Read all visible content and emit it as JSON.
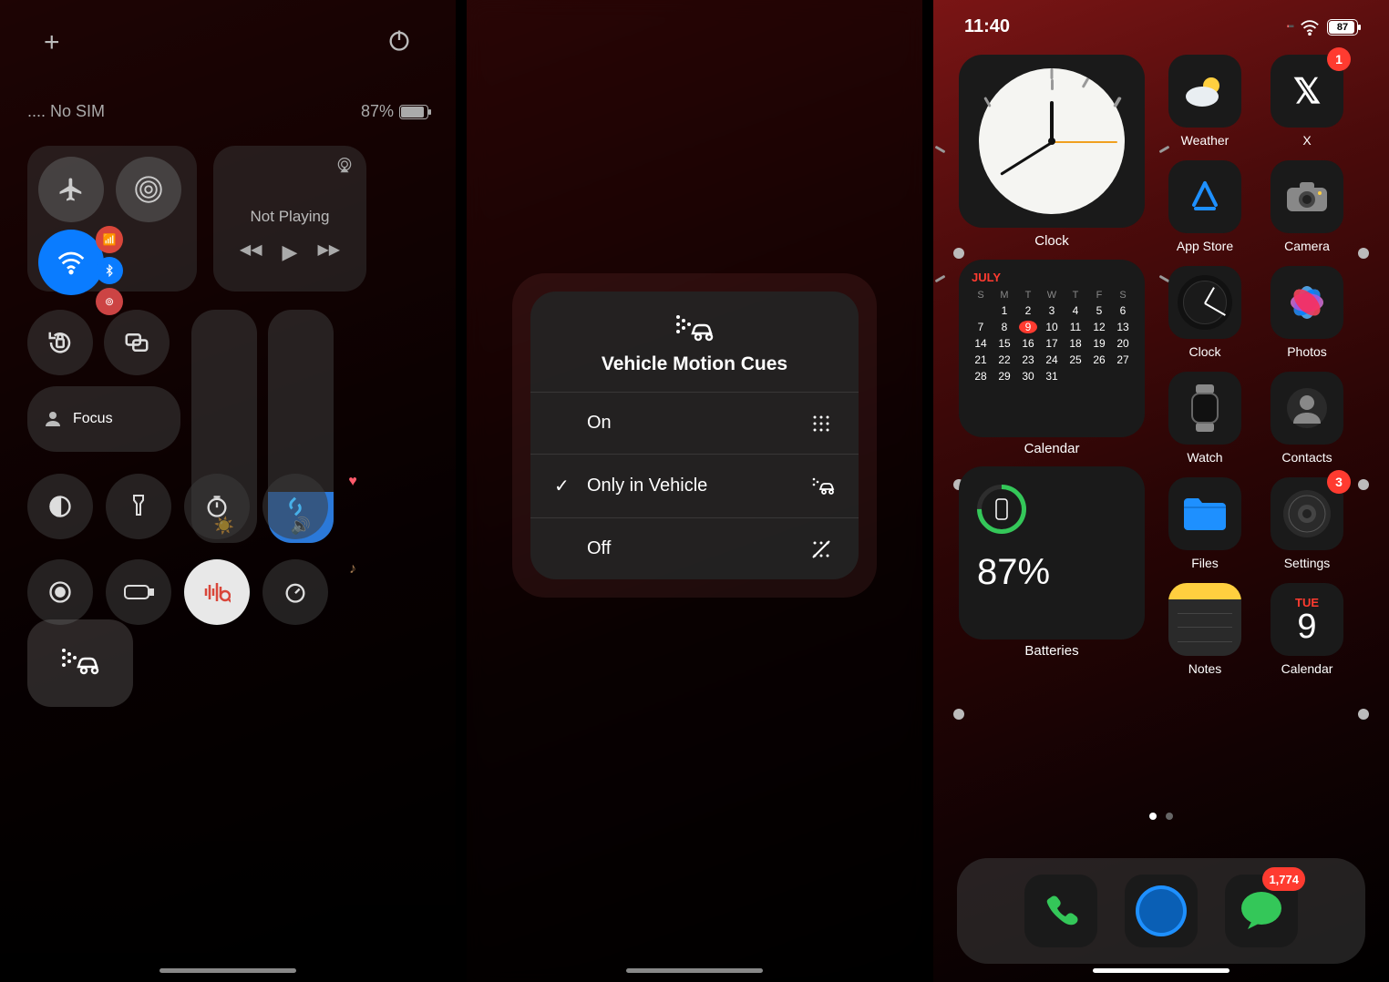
{
  "screens": {
    "control_center": {
      "status": {
        "carrier": ".... No SIM",
        "battery_text": "87%"
      },
      "media": {
        "now_playing": "Not Playing"
      },
      "focus_label": "Focus"
    },
    "motion_menu": {
      "title": "Vehicle Motion Cues",
      "options": [
        {
          "label": "On",
          "checked": false
        },
        {
          "label": "Only in Vehicle",
          "checked": true
        },
        {
          "label": "Off",
          "checked": false
        }
      ]
    },
    "home": {
      "time": "11:40",
      "battery_pct": "87",
      "clock_widget_label": "Clock",
      "calendar_widget_label": "Calendar",
      "batteries_widget_label": "Batteries",
      "battery_widget_value": "87%",
      "calendar": {
        "month": "JULY",
        "dow": [
          "S",
          "M",
          "T",
          "W",
          "T",
          "F",
          "S"
        ],
        "weeks": [
          [
            "",
            "1",
            "2",
            "3",
            "4",
            "5",
            "6"
          ],
          [
            "7",
            "8",
            "9",
            "10",
            "11",
            "12",
            "13"
          ],
          [
            "14",
            "15",
            "16",
            "17",
            "18",
            "19",
            "20"
          ],
          [
            "21",
            "22",
            "23",
            "24",
            "25",
            "26",
            "27"
          ],
          [
            "28",
            "29",
            "30",
            "31",
            "",
            "",
            ""
          ]
        ],
        "today": "9"
      },
      "apps": {
        "weather": "Weather",
        "x": "X",
        "x_badge": "1",
        "appstore": "App Store",
        "camera": "Camera",
        "clock2": "Clock",
        "photos": "Photos",
        "watch": "Watch",
        "contacts": "Contacts",
        "files": "Files",
        "settings": "Settings",
        "settings_badge": "3",
        "notes": "Notes",
        "calendar2": "Calendar",
        "calendar2_dow": "TUE",
        "calendar2_day": "9",
        "messages_badge": "1,774"
      }
    }
  }
}
